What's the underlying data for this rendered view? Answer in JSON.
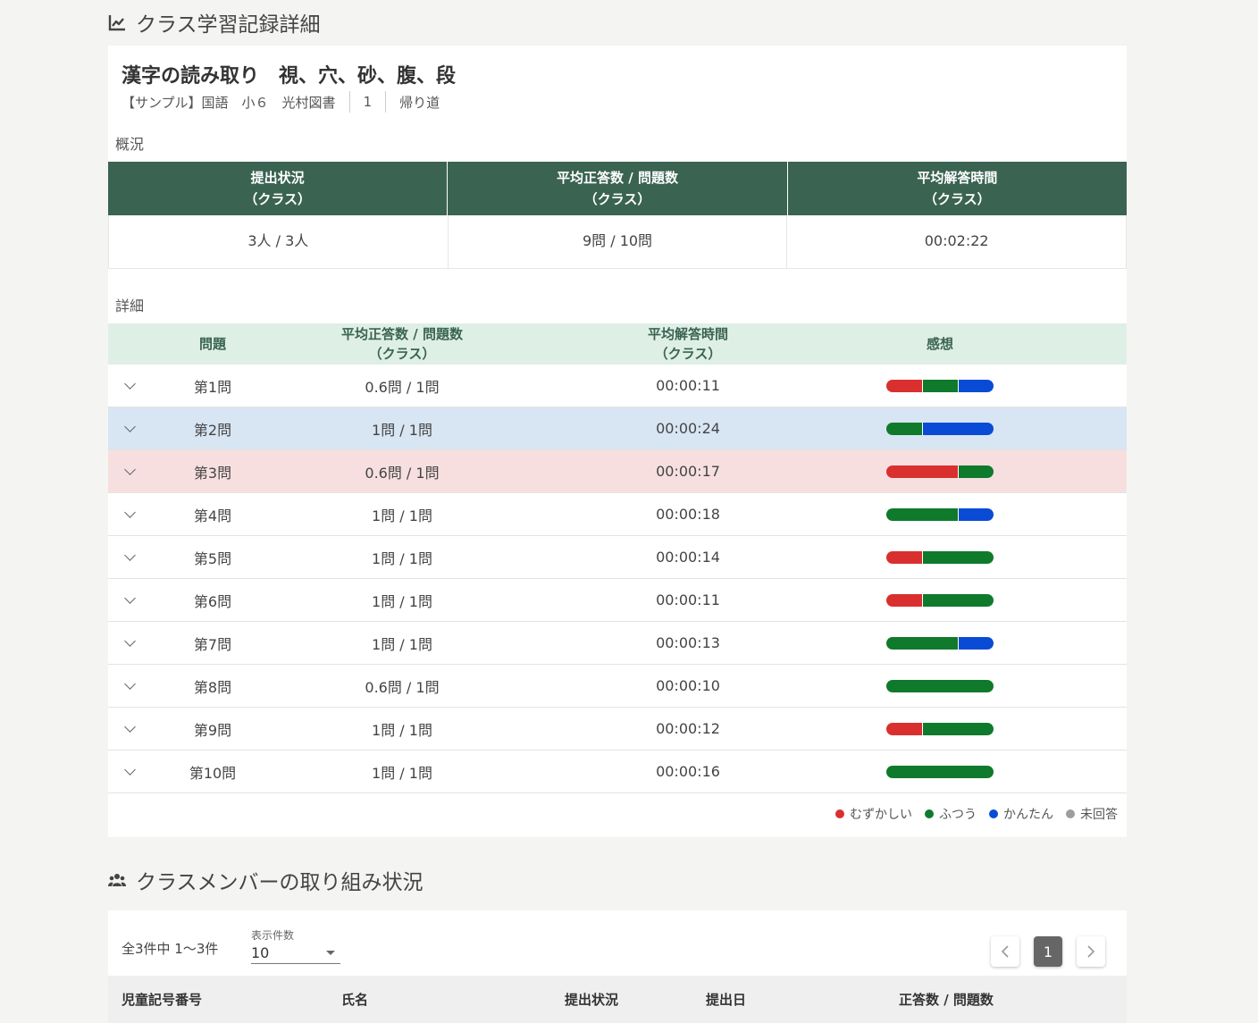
{
  "page": {
    "section1_title": "クラス学習記録詳細",
    "section2_title": "クラスメンバーの取り組み状況"
  },
  "lesson": {
    "title": "漢字の読み取り　視、穴、砂、腹、段",
    "meta": [
      "【サンプル】国語　小６　光村図書",
      "1",
      "帰り道"
    ]
  },
  "overview": {
    "label": "概況",
    "headers": [
      {
        "line1": "提出状況",
        "line2": "（クラス）"
      },
      {
        "line1": "平均正答数 / 問題数",
        "line2": "（クラス）"
      },
      {
        "line1": "平均解答時間",
        "line2": "（クラス）"
      }
    ],
    "values": [
      "3人 / 3人",
      "9問 / 10問",
      "00:02:22"
    ]
  },
  "detail": {
    "label": "詳細",
    "headers": {
      "question": "問題",
      "score_line1": "平均正答数 / 問題数",
      "score_line2": "（クラス）",
      "time_line1": "平均解答時間",
      "time_line2": "（クラス）",
      "feedback": "感想"
    },
    "rows": [
      {
        "q": "第1問",
        "score": "0.6問 / 1問",
        "time": "00:00:11",
        "highlight": "none",
        "feedback": {
          "hard": 1,
          "normal": 1,
          "easy": 1,
          "none": 0
        }
      },
      {
        "q": "第2問",
        "score": "1問 / 1問",
        "time": "00:00:24",
        "highlight": "blue",
        "feedback": {
          "hard": 0,
          "normal": 1,
          "easy": 2,
          "none": 0
        }
      },
      {
        "q": "第3問",
        "score": "0.6問 / 1問",
        "time": "00:00:17",
        "highlight": "pink",
        "feedback": {
          "hard": 2,
          "normal": 1,
          "easy": 0,
          "none": 0
        }
      },
      {
        "q": "第4問",
        "score": "1問 / 1問",
        "time": "00:00:18",
        "highlight": "none",
        "feedback": {
          "hard": 0,
          "normal": 2,
          "easy": 1,
          "none": 0
        }
      },
      {
        "q": "第5問",
        "score": "1問 / 1問",
        "time": "00:00:14",
        "highlight": "none",
        "feedback": {
          "hard": 1,
          "normal": 2,
          "easy": 0,
          "none": 0
        }
      },
      {
        "q": "第6問",
        "score": "1問 / 1問",
        "time": "00:00:11",
        "highlight": "none",
        "feedback": {
          "hard": 1,
          "normal": 2,
          "easy": 0,
          "none": 0
        }
      },
      {
        "q": "第7問",
        "score": "1問 / 1問",
        "time": "00:00:13",
        "highlight": "none",
        "feedback": {
          "hard": 0,
          "normal": 2,
          "easy": 1,
          "none": 0
        }
      },
      {
        "q": "第8問",
        "score": "0.6問 / 1問",
        "time": "00:00:10",
        "highlight": "none",
        "feedback": {
          "hard": 0,
          "normal": 3,
          "easy": 0,
          "none": 0
        }
      },
      {
        "q": "第9問",
        "score": "1問 / 1問",
        "time": "00:00:12",
        "highlight": "none",
        "feedback": {
          "hard": 1,
          "normal": 2,
          "easy": 0,
          "none": 0
        }
      },
      {
        "q": "第10問",
        "score": "1問 / 1問",
        "time": "00:00:16",
        "highlight": "none",
        "feedback": {
          "hard": 0,
          "normal": 3,
          "easy": 0,
          "none": 0
        }
      }
    ],
    "legend": [
      {
        "label": "むずかしい",
        "color": "#d9302f"
      },
      {
        "label": "ふつう",
        "color": "#0f7a2b"
      },
      {
        "label": "かんたん",
        "color": "#0a4bd6"
      },
      {
        "label": "未回答",
        "color": "#9e9e9e"
      }
    ]
  },
  "members": {
    "count_text": "全3件中 1〜3件",
    "per_page_label": "表示件数",
    "per_page_value": "10",
    "current_page": "1",
    "headers": {
      "id": "児童記号番号",
      "name": "氏名",
      "status": "提出状況",
      "date": "提出日",
      "score": "正答数 / 問題数"
    }
  },
  "icons": [
    "chart-line-icon",
    "users-icon",
    "chevron-down-icon",
    "chevron-left-icon",
    "chevron-right-icon",
    "dropdown-caret-icon"
  ]
}
